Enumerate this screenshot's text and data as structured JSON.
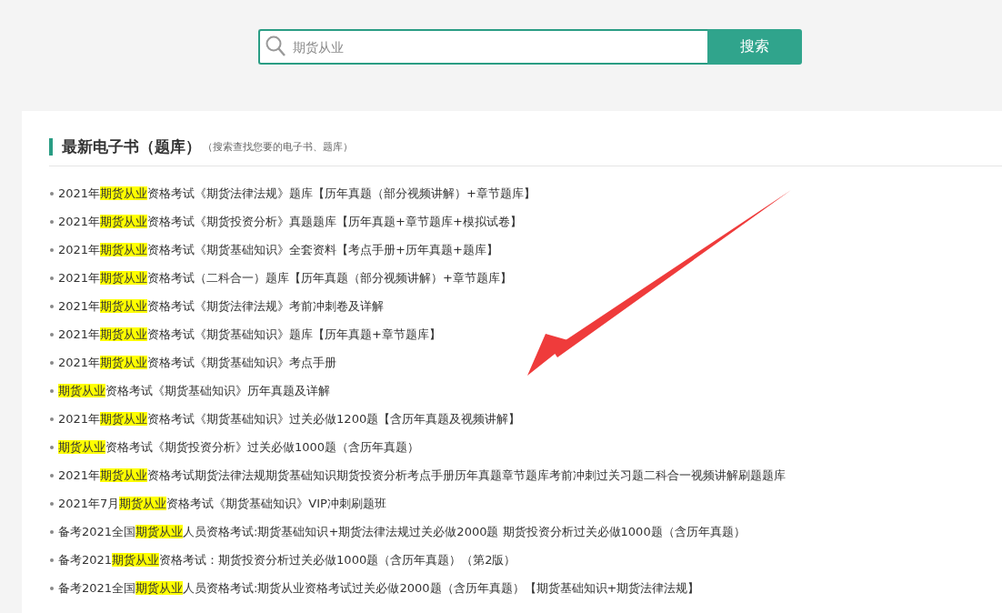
{
  "search": {
    "placeholder": "期货从业",
    "button": "搜索"
  },
  "section": {
    "title": "最新电子书（题库）",
    "subtitle": "（搜索查找您要的电子书、题库）",
    "items": [
      {
        "before": "2021年",
        "highlight": "期货从业",
        "after": "资格考试《期货法律法规》题库【历年真题（部分视频讲解）+章节题库】"
      },
      {
        "before": "2021年",
        "highlight": "期货从业",
        "after": "资格考试《期货投资分析》真题题库【历年真题+章节题库+模拟试卷】"
      },
      {
        "before": "2021年",
        "highlight": "期货从业",
        "after": "资格考试《期货基础知识》全套资料【考点手册+历年真题+题库】"
      },
      {
        "before": "2021年",
        "highlight": "期货从业",
        "after": "资格考试（二科合一）题库【历年真题（部分视频讲解）+章节题库】"
      },
      {
        "before": "2021年",
        "highlight": "期货从业",
        "after": "资格考试《期货法律法规》考前冲刺卷及详解"
      },
      {
        "before": "2021年",
        "highlight": "期货从业",
        "after": "资格考试《期货基础知识》题库【历年真题+章节题库】"
      },
      {
        "before": "2021年",
        "highlight": "期货从业",
        "after": "资格考试《期货基础知识》考点手册"
      },
      {
        "highlight": "期货从业",
        "after": "资格考试《期货基础知识》历年真题及详解"
      },
      {
        "before": "2021年",
        "highlight": "期货从业",
        "after": "资格考试《期货基础知识》过关必做1200题【含历年真题及视频讲解】"
      },
      {
        "highlight": "期货从业",
        "after": "资格考试《期货投资分析》过关必做1000题（含历年真题）"
      },
      {
        "before": "2021年",
        "highlight": "期货从业",
        "after": "资格考试期货法律法规期货基础知识期货投资分析考点手册历年真题章节题库考前冲刺过关习题二科合一视频讲解刷题题库"
      },
      {
        "before": "2021年7月",
        "highlight": "期货从业",
        "after": "资格考试《期货基础知识》VIP冲刺刷题班"
      },
      {
        "before": "备考2021全国",
        "highlight": "期货从业",
        "after": "人员资格考试:期货基础知识+期货法律法规过关必做2000题 期货投资分析过关必做1000题（含历年真题）"
      },
      {
        "before": "备考2021",
        "highlight": "期货从业",
        "after": "资格考试：期货投资分析过关必做1000题（含历年真题）（第2版）"
      },
      {
        "before": "备考2021全国",
        "highlight": "期货从业",
        "after": "人员资格考试:期货从业资格考试过关必做2000题（含历年真题）【期货基础知识+期货法律法规】"
      }
    ]
  }
}
